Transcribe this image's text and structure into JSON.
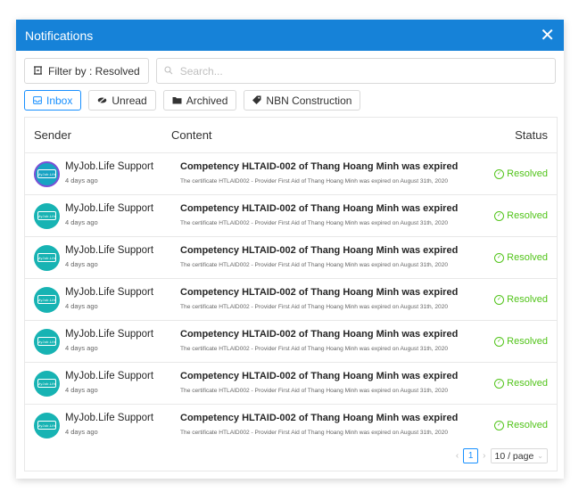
{
  "modal": {
    "title": "Notifications",
    "close_glyph": "✕"
  },
  "toolbar": {
    "filter_label": "Filter by : Resolved",
    "filter_icon": "filter-icon",
    "search_placeholder": "Search...",
    "search_icon": "search-icon"
  },
  "tabs": [
    {
      "label": "Inbox",
      "icon": "inbox-icon",
      "active": true
    },
    {
      "label": "Unread",
      "icon": "eye-slash-icon",
      "active": false
    },
    {
      "label": "Archived",
      "icon": "folder-icon",
      "active": false
    },
    {
      "label": "NBN Construction",
      "icon": "tag-icon",
      "active": false
    }
  ],
  "table": {
    "headers": {
      "sender": "Sender",
      "content": "Content",
      "status": "Status"
    },
    "rows": [
      {
        "sender": "MyJob.Life Support",
        "time": "4 days ago",
        "title": "Competency HLTAID-002 of Thang Hoang Minh was expired",
        "desc": "The certificate HTLAID002 - Provider First Aid of Thang Hoang Minh was expired on August 31th, 2020",
        "status": "Resolved",
        "avatar_text": "MyJob.Life"
      },
      {
        "sender": "MyJob.Life Support",
        "time": "4 days ago",
        "title": "Competency HLTAID-002 of Thang Hoang Minh was expired",
        "desc": "The certificate HTLAID002 - Provider First Aid of Thang Hoang Minh was expired on August 31th, 2020",
        "status": "Resolved",
        "avatar_text": "MyJob.Life"
      },
      {
        "sender": "MyJob.Life Support",
        "time": "4 days ago",
        "title": "Competency HLTAID-002 of Thang Hoang Minh was expired",
        "desc": "The certificate HTLAID002 - Provider First Aid of Thang Hoang Minh was expired on August 31th, 2020",
        "status": "Resolved",
        "avatar_text": "MyJob.Life"
      },
      {
        "sender": "MyJob.Life Support",
        "time": "4 days ago",
        "title": "Competency HLTAID-002 of Thang Hoang Minh was expired",
        "desc": "The certificate HTLAID002 - Provider First Aid of Thang Hoang Minh was expired on August 31th, 2020",
        "status": "Resolved",
        "avatar_text": "MyJob.Life"
      },
      {
        "sender": "MyJob.Life Support",
        "time": "4 days ago",
        "title": "Competency HLTAID-002 of Thang Hoang Minh was expired",
        "desc": "The certificate HTLAID002 - Provider First Aid of Thang Hoang Minh was expired on August 31th, 2020",
        "status": "Resolved",
        "avatar_text": "MyJob.Life"
      },
      {
        "sender": "MyJob.Life Support",
        "time": "4 days ago",
        "title": "Competency HLTAID-002 of Thang Hoang Minh was expired",
        "desc": "The certificate HTLAID002 - Provider First Aid of Thang Hoang Minh was expired on August 31th, 2020",
        "status": "Resolved",
        "avatar_text": "MyJob.Life"
      },
      {
        "sender": "MyJob.Life Support",
        "time": "4 days ago",
        "title": "Competency HLTAID-002 of Thang Hoang Minh was expired",
        "desc": "The certificate HTLAID002 - Provider First Aid of Thang Hoang Minh was expired on August 31th, 2020",
        "status": "Resolved",
        "avatar_text": "MyJob.Life"
      }
    ]
  },
  "pagination": {
    "prev_glyph": "‹",
    "current_page": "1",
    "next_glyph": "›",
    "page_size": "10 / page"
  },
  "colors": {
    "header": "#1682d8",
    "accent": "#1890ff",
    "resolved": "#52c41a",
    "avatar": "#17b3b3"
  }
}
